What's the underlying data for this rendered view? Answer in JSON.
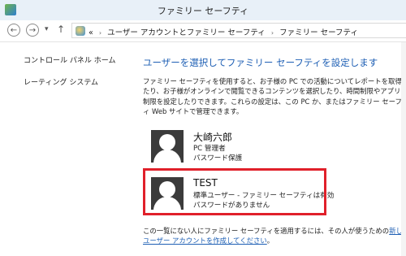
{
  "window": {
    "title": "ファミリー セーフティ"
  },
  "nav": {
    "back_glyph": "←",
    "forward_glyph": "→",
    "up_glyph": "↑",
    "breadcrumbs": [
      "«",
      "ユーザー アカウントとファミリー セーフティ",
      "ファミリー セーフティ"
    ]
  },
  "sidebar": {
    "items": [
      {
        "label": "コントロール パネル ホーム"
      },
      {
        "label": "レーティング システム"
      }
    ]
  },
  "main": {
    "heading": "ユーザーを選択してファミリー セーフティを設定します",
    "description": "ファミリー セーフティを使用すると、お子様の PC での活動についてレポートを取得したり、お子様がオンラインで閲覧できるコンテンツを選択したり、時間制限やアプリの制限を設定したりできます。これらの設定は、この PC か、またはファミリー セーフティ Web サイトで管理できます。",
    "users": [
      {
        "name": "大崎六郎",
        "lines": [
          "PC 管理者",
          "パスワード保護"
        ]
      },
      {
        "name": "TEST",
        "lines": [
          "標準ユーザー - ファミリー セーフティは有効",
          "パスワードがありません"
        ]
      }
    ],
    "footer_text": "この一覧にない人にファミリー セーフティを適用するには、その人が使うための",
    "footer_link": "新しいユーザー アカウントを作成してください",
    "footer_end": "。"
  },
  "colors": {
    "accent": "#1e5fb4",
    "highlight": "#e0202a"
  }
}
